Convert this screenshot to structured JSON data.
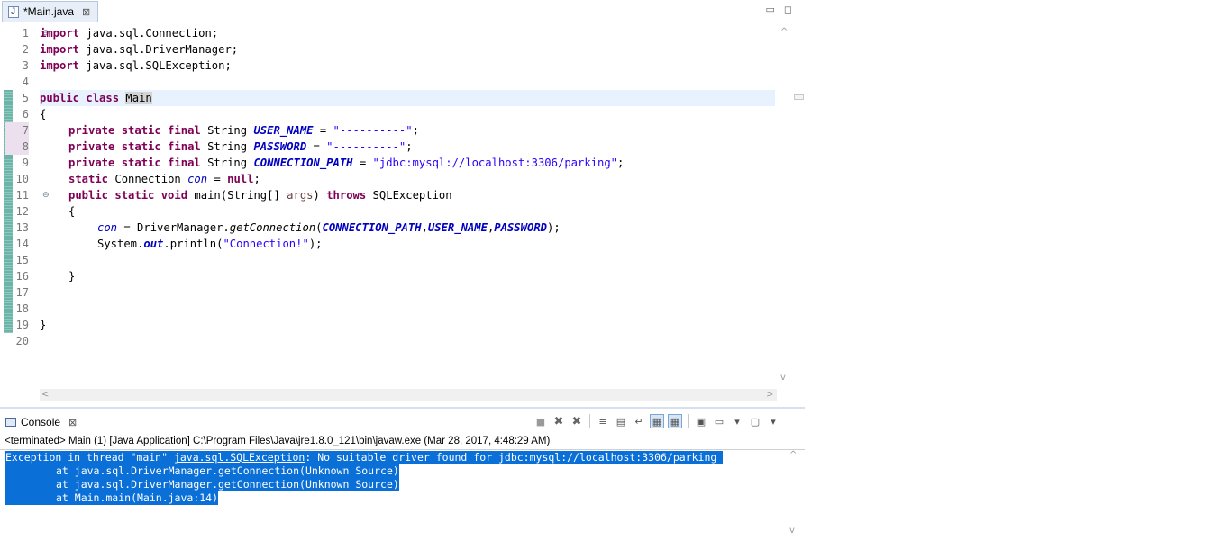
{
  "editor_tab": {
    "title": "*Main.java",
    "close": "⊠"
  },
  "window_controls": {
    "minimize": "▭",
    "maximize": "◻"
  },
  "line_numbers": [
    "1",
    "2",
    "3",
    "4",
    "5",
    "6",
    "7",
    "8",
    "9",
    "10",
    "11",
    "12",
    "13",
    "14",
    "15",
    "16",
    "17",
    "18",
    "19",
    "20"
  ],
  "fold_markers": {
    "1": "⊖",
    "11": "⊖"
  },
  "code": {
    "l1": {
      "kw": "import",
      "rest": " java.sql.Connection;"
    },
    "l2": {
      "kw": "import",
      "rest": " java.sql.DriverManager;"
    },
    "l3": {
      "kw": "import",
      "rest": " java.sql.SQLException;"
    },
    "l5": {
      "kw": "public class",
      "sp": " ",
      "name": "Main"
    },
    "l6": "{",
    "l7": {
      "kw": "private static final",
      "type": " String ",
      "field": "USER_NAME",
      "eq": " = ",
      "str": "\"----------\"",
      "end": ";"
    },
    "l8": {
      "kw": "private static final",
      "type": " String ",
      "field": "PASSWORD",
      "eq": " = ",
      "str": "\"----------\"",
      "end": ";"
    },
    "l9": {
      "kw": "private static final",
      "type": " String ",
      "field": "CONNECTION_PATH",
      "eq": " = ",
      "str": "\"jdbc:mysql://localhost:3306/parking\"",
      "end": ";"
    },
    "l10": {
      "kw": "static",
      "type": " Connection ",
      "field": "con",
      "eq": " = ",
      "kw2": "null",
      "end": ";"
    },
    "l11": {
      "kw": "public static void",
      "mid": " main(String[] ",
      "arg": "args",
      "sp": ") ",
      "kw2": "throws",
      "end": " SQLException"
    },
    "l12": "{",
    "l13": {
      "field": "con",
      "a": " = DriverManager.",
      "meth": "getConnection",
      "b": "(",
      "f1": "CONNECTION_PATH",
      "c1": ",",
      "f2": "USER_NAME",
      "c2": ",",
      "f3": "PASSWORD",
      "end": ");"
    },
    "l14": {
      "a": "System.",
      "out": "out",
      "b": ".println(",
      "str": "\"Connection!\"",
      "end": ");"
    },
    "l16": "}",
    "l19": "}"
  },
  "console": {
    "tab_title": "Console",
    "close": "⊠",
    "terminated": "<terminated> Main (1) [Java Application] C:\\Program Files\\Java\\jre1.8.0_121\\bin\\javaw.exe (Mar 28, 2017, 4:48:29 AM)",
    "output": {
      "l1_pre": "Exception in thread \"main\" ",
      "l1_link": "java.sql.SQLException",
      "l1_post": ": No suitable driver found for jdbc:mysql://localhost:3306/parking",
      "l2": "\tat java.sql.DriverManager.getConnection(Unknown Source)",
      "l3": "\tat java.sql.DriverManager.getConnection(Unknown Source)",
      "l4": "\tat Main.main(Main.java:14)"
    }
  },
  "toolbar": {
    "stop": "■",
    "remove": "✖",
    "remove_all": "✖",
    "scroll_lock": "≡",
    "pin": "▤",
    "word_wrap": "↵",
    "show_out": "▦",
    "show_err": "▦",
    "open_console": "▣",
    "display": "▭",
    "new_console": "▢",
    "dropdown": "▾"
  },
  "scroll": {
    "up": "^",
    "down": "v",
    "left": "<",
    "right": ">"
  }
}
